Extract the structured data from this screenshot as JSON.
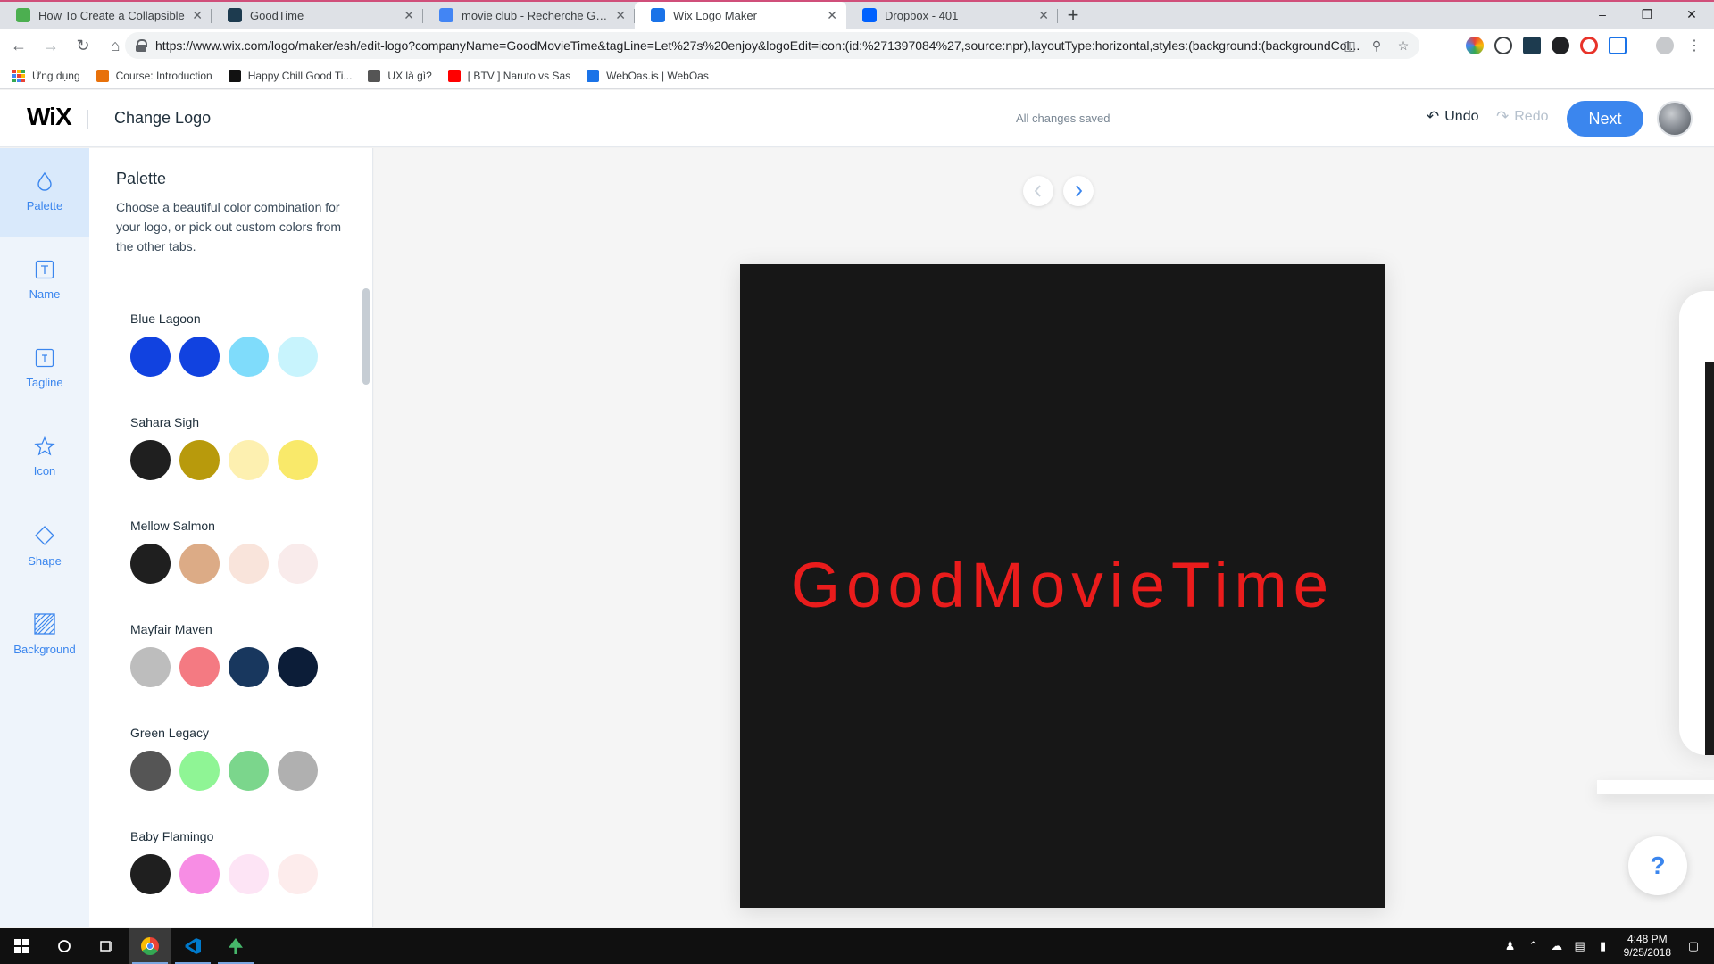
{
  "browser": {
    "tabs": [
      {
        "title": "How To Create a Collapsible",
        "favicon_color": "#4caf50",
        "active": false
      },
      {
        "title": "GoodTime",
        "favicon_color": "#1d3b4f",
        "active": false
      },
      {
        "title": "movie club - Recherche Google",
        "favicon_color": "#4285f4",
        "active": false
      },
      {
        "title": "Wix Logo Maker",
        "favicon_color": "#1a73e8",
        "active": true
      },
      {
        "title": "Dropbox - 401",
        "favicon_color": "#0061fe",
        "active": false
      }
    ],
    "url": "https://www.wix.com/logo/maker/esh/edit-logo?companyName=GoodMovieTime&tagLine=Let%27s%20enjoy&logoEdit=icon:(id:%271397084%27,source:npr),layoutType:horizontal,styles:(background:(backgroundCol...",
    "bookmarks": [
      {
        "label": "Ứng dụng",
        "icon": "apps-grid"
      },
      {
        "label": "Course: Introduction",
        "icon_color": "#e8710a"
      },
      {
        "label": "Happy Chill Good Ti...",
        "icon_color": "#111111"
      },
      {
        "label": "UX là gì?",
        "icon_color": "#555555"
      },
      {
        "label": "[ BTV ] Naruto vs Sas",
        "icon_color": "#ff0000"
      },
      {
        "label": "WebOas.is | WebOas",
        "icon_color": "#1a73e8"
      }
    ]
  },
  "header": {
    "brand": "WiX",
    "title": "Change Logo",
    "status": "All changes saved",
    "undo_label": "Undo",
    "redo_label": "Redo",
    "next_label": "Next"
  },
  "rail": {
    "items": [
      {
        "label": "Palette",
        "icon": "drop-icon",
        "active": true
      },
      {
        "label": "Name",
        "icon": "text-icon",
        "active": false
      },
      {
        "label": "Tagline",
        "icon": "text-small-icon",
        "active": false
      },
      {
        "label": "Icon",
        "icon": "star-icon",
        "active": false
      },
      {
        "label": "Shape",
        "icon": "diamond-icon",
        "active": false
      },
      {
        "label": "Background",
        "icon": "hatch-icon",
        "active": false
      }
    ]
  },
  "panel": {
    "title": "Palette",
    "description": "Choose a beautiful color combination for your logo, or pick out custom colors from the other tabs.",
    "palettes": [
      {
        "name": "Blue Lagoon",
        "colors": [
          "#1142e0",
          "#1142e0",
          "#7fdcfb",
          "#c8f4fd"
        ]
      },
      {
        "name": "Sahara Sigh",
        "colors": [
          "#1f1f1f",
          "#b89a0c",
          "#fdf0b0",
          "#f9e96a"
        ]
      },
      {
        "name": "Mellow Salmon",
        "colors": [
          "#1f1f1f",
          "#dcab86",
          "#f9e4db",
          "#f9ebeb"
        ]
      },
      {
        "name": "Mayfair Maven",
        "colors": [
          "#bdbdbd",
          "#f47a82",
          "#18375e",
          "#0c1d38"
        ]
      },
      {
        "name": "Green Legacy",
        "colors": [
          "#555555",
          "#8ff595",
          "#7bd68c",
          "#b0b0b0"
        ]
      },
      {
        "name": "Baby Flamingo",
        "colors": [
          "#1f1f1f",
          "#f78de4",
          "#fde4f5",
          "#fdecec"
        ]
      }
    ]
  },
  "canvas": {
    "logo_text": "GoodMovieTime",
    "logo_text_color": "#ea1c1c",
    "logo_background": "#171717",
    "help_label": "?"
  },
  "taskbar": {
    "time": "4:48 PM",
    "date": "9/25/2018"
  }
}
